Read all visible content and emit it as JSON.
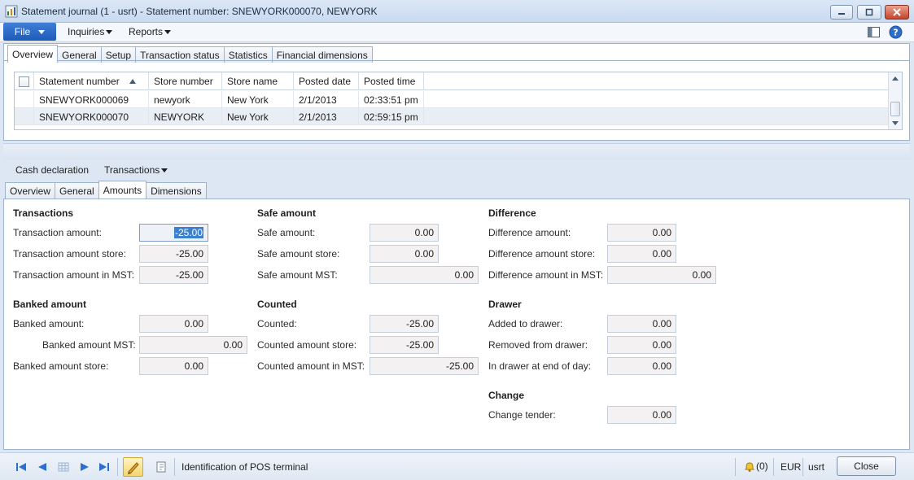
{
  "window": {
    "title": "Statement journal (1 - usrt) - Statement number: SNEWYORK000070, NEWYORK",
    "minimize": "minimize",
    "maximize": "maximize",
    "close": "close"
  },
  "menu": {
    "file": "File",
    "inquiries": "Inquiries",
    "reports": "Reports"
  },
  "top_tabs": [
    "Overview",
    "General",
    "Setup",
    "Transaction status",
    "Statistics",
    "Financial dimensions"
  ],
  "grid": {
    "columns": [
      "Statement number",
      "Store number",
      "Store name",
      "Posted date",
      "Posted time"
    ],
    "rows": [
      {
        "statement": "SNEWYORK000069",
        "store_number": "newyork",
        "store_name": "New York",
        "posted_date": "2/1/2013",
        "posted_time": "02:33:51 pm"
      },
      {
        "statement": "SNEWYORK000070",
        "store_number": "NEWYORK",
        "store_name": "New York",
        "posted_date": "2/1/2013",
        "posted_time": "02:59:15 pm"
      }
    ]
  },
  "actions": {
    "cash_declaration": "Cash declaration",
    "transactions": "Transactions"
  },
  "bottom_tabs": [
    "Overview",
    "General",
    "Amounts",
    "Dimensions"
  ],
  "amounts": {
    "transactions": {
      "title": "Transactions",
      "transaction_amount_label": "Transaction amount:",
      "transaction_amount": "-25.00",
      "transaction_amount_store_label": "Transaction amount store:",
      "transaction_amount_store": "-25.00",
      "transaction_amount_mst_label": "Transaction amount in MST:",
      "transaction_amount_mst": "-25.00"
    },
    "banked": {
      "title": "Banked amount",
      "banked_amount_label": "Banked amount:",
      "banked_amount": "0.00",
      "banked_amount_mst_label": "Banked amount MST:",
      "banked_amount_mst": "0.00",
      "banked_amount_store_label": "Banked amount store:",
      "banked_amount_store": "0.00"
    },
    "safe": {
      "title": "Safe amount",
      "safe_amount_label": "Safe amount:",
      "safe_amount": "0.00",
      "safe_amount_store_label": "Safe amount store:",
      "safe_amount_store": "0.00",
      "safe_amount_mst_label": "Safe amount MST:",
      "safe_amount_mst": "0.00"
    },
    "counted": {
      "title": "Counted",
      "counted_label": "Counted:",
      "counted": "-25.00",
      "counted_store_label": "Counted amount store:",
      "counted_store": "-25.00",
      "counted_mst_label": "Counted amount in MST:",
      "counted_mst": "-25.00"
    },
    "difference": {
      "title": "Difference",
      "difference_amount_label": "Difference amount:",
      "difference_amount": "0.00",
      "difference_store_label": "Difference amount store:",
      "difference_store": "0.00",
      "difference_mst_label": "Difference amount in MST:",
      "difference_mst": "0.00"
    },
    "drawer": {
      "title": "Drawer",
      "added_label": "Added to drawer:",
      "added": "0.00",
      "removed_label": "Removed from drawer:",
      "removed": "0.00",
      "end_of_day_label": "In drawer at end of day:",
      "end_of_day": "0.00"
    },
    "change": {
      "title": "Change",
      "change_tender_label": "Change tender:",
      "change_tender": "0.00"
    }
  },
  "status": {
    "field_help": "Identification of POS terminal",
    "notifications": "(0)",
    "currency": "EUR",
    "user": "usrt",
    "close_button": "Close"
  }
}
